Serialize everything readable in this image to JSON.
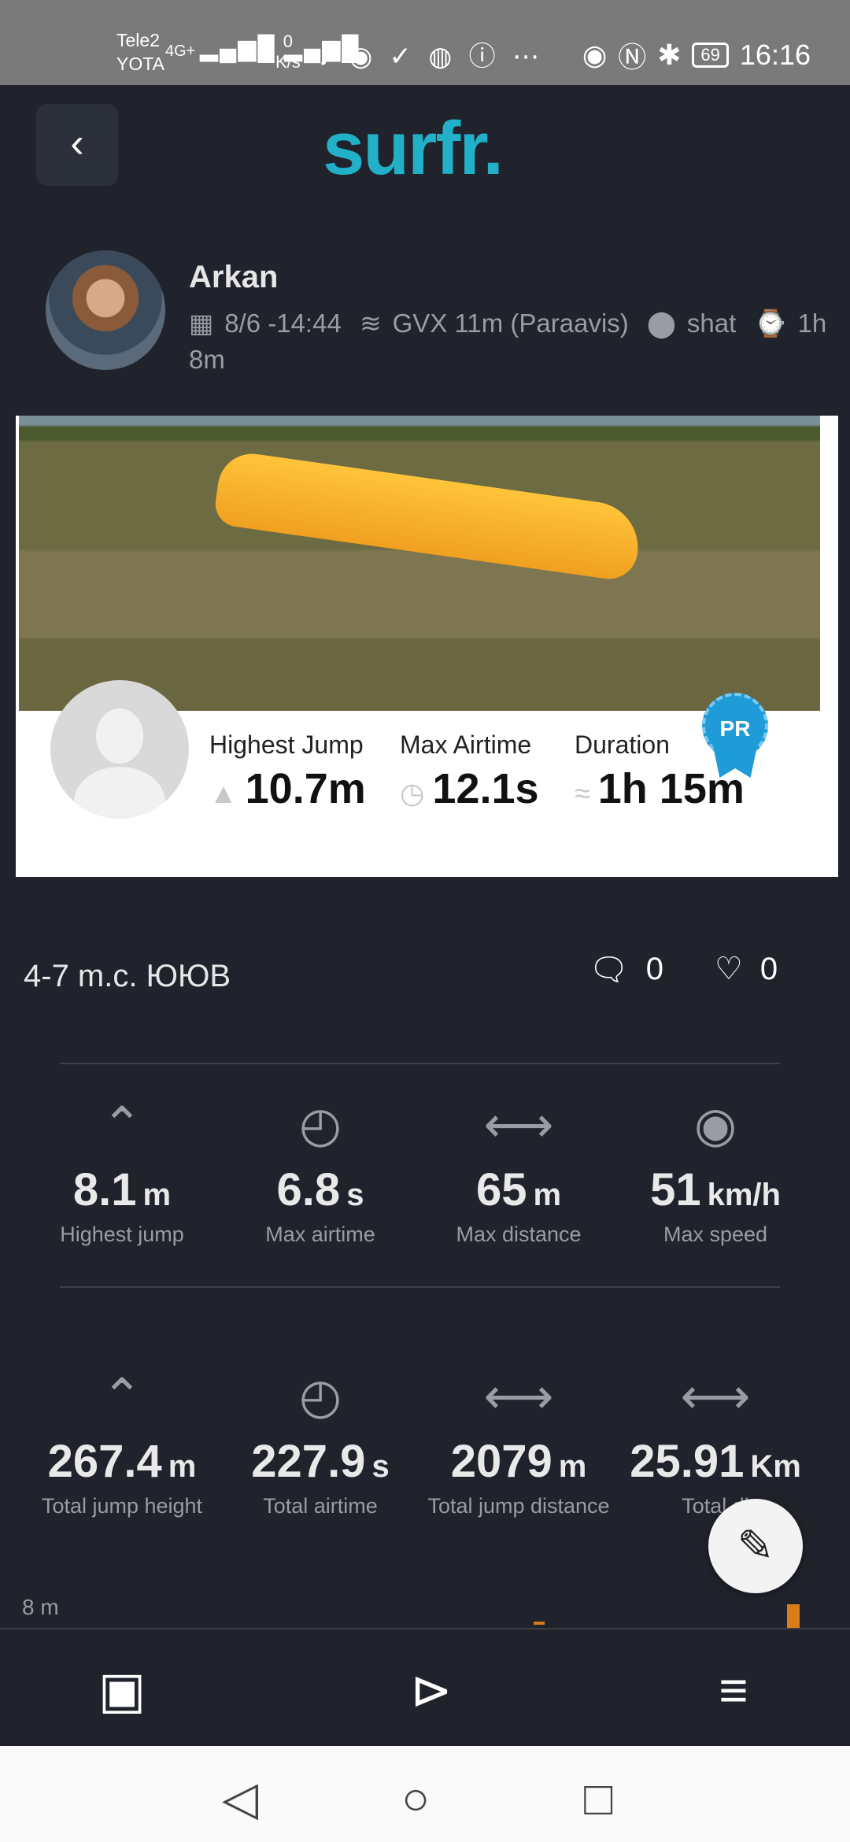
{
  "status_bar": {
    "carrier_1": "Tele2",
    "carrier_2": "YOTA",
    "network": "4G+",
    "speed_value": "0",
    "speed_unit": "K/s",
    "battery": "69",
    "time": "16:16"
  },
  "header": {
    "logo": "surfr.",
    "back_icon": "chevron-left-icon"
  },
  "profile": {
    "name": "Arkan",
    "date": "8/6 -14:44",
    "gear": "GVX 11m (Paraavis)",
    "spot": "shat",
    "duration": "1h 8m"
  },
  "banner": {
    "badge": "PR",
    "stats": [
      {
        "label": "Highest Jump",
        "value": "10.7m",
        "icon": "triangle-icon"
      },
      {
        "label": "Max Airtime",
        "value": "12.1s",
        "icon": "stopwatch-icon"
      },
      {
        "label": "Duration",
        "value": "1h 15m",
        "icon": "wave-icon"
      }
    ]
  },
  "session": {
    "title": "4-7 m.c. ЮЮВ",
    "comments": "0",
    "likes": "0"
  },
  "stats_row_1": [
    {
      "icon": "jump-up-icon",
      "value": "8.1",
      "unit": "m",
      "label": "Highest jump"
    },
    {
      "icon": "timer-icon",
      "value": "6.8",
      "unit": "s",
      "label": "Max airtime"
    },
    {
      "icon": "distance-arrows-icon",
      "value": "65",
      "unit": "m",
      "label": "Max distance"
    },
    {
      "icon": "speedometer-icon",
      "value": "51",
      "unit": "km/h",
      "label": "Max speed"
    }
  ],
  "stats_row_2": [
    {
      "icon": "double-chevron-up-icon",
      "value": "267.4",
      "unit": "m",
      "label": "Total jump height"
    },
    {
      "icon": "timer-icon",
      "value": "227.9",
      "unit": "s",
      "label": "Total airtime"
    },
    {
      "icon": "distance-arrows-icon",
      "value": "2079",
      "unit": "m",
      "label": "Total jump distance"
    },
    {
      "icon": "distance-arrows-icon",
      "value": "25.91",
      "unit": "Km",
      "label": "Total di"
    }
  ],
  "chart_strip": {
    "axis_label": "8 m"
  },
  "bottom_nav": {
    "items": [
      "feed-icon",
      "play-icon",
      "menu-icon"
    ]
  },
  "colors": {
    "background": "#20232b",
    "accent": "#21b0c8",
    "chart_bar": "#d97d18",
    "badge": "#1f9bd8"
  }
}
